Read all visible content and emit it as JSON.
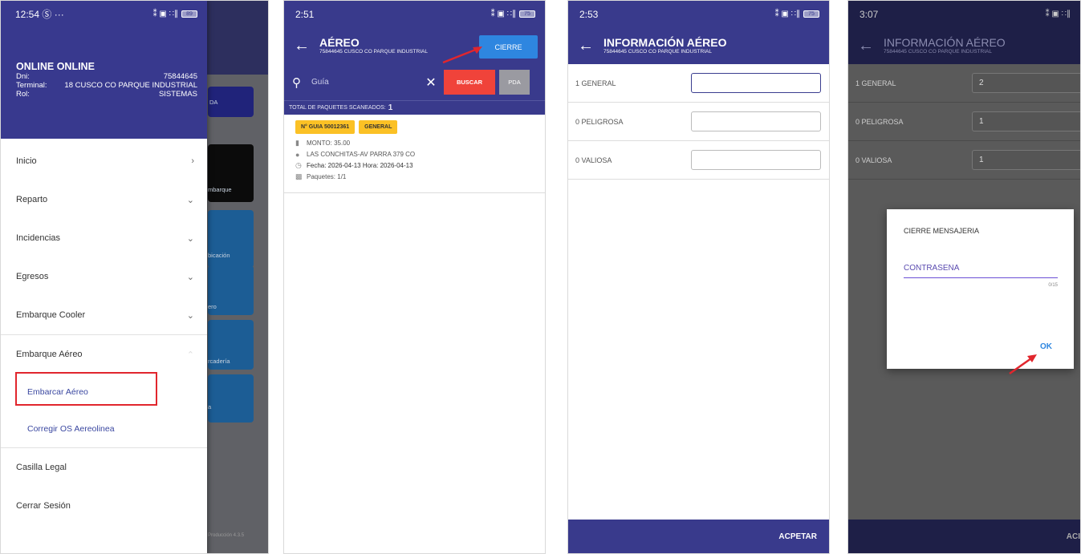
{
  "screen1": {
    "status_time": "12:54",
    "status_extra": "Ⓢ ···",
    "status_icons": "⁑ ▣ ∷∥",
    "battery": "89",
    "user_name": "ONLINE ONLINE",
    "dni_label": "Dni:",
    "dni_value": "75844645",
    "terminal_label": "Terminal:",
    "terminal_value": "18 CUSCO CO PARQUE INDUSTRIAL",
    "rol_label": "Rol:",
    "rol_value": "SISTEMAS",
    "menu": [
      {
        "label": "Inicio",
        "icon": "›"
      },
      {
        "label": "Reparto",
        "icon": "⌄"
      },
      {
        "label": "Incidencias",
        "icon": "⌄"
      },
      {
        "label": "Egresos",
        "icon": "⌄"
      },
      {
        "label": "Embarque Cooler",
        "icon": "⌄"
      },
      {
        "label": "Embarque Aéreo",
        "icon": "⌃"
      }
    ],
    "submenu": [
      "Embarcar Aéreo",
      "Corregir OS Aereolinea"
    ],
    "menu_bottom": [
      "Casilla Legal",
      "Cerrar Sesión"
    ],
    "bg_tiles": [
      "mbarque",
      "bicación",
      "ero",
      "rcadería",
      "a"
    ],
    "bg_partial": "DA",
    "footer": "Producción 4.3.5"
  },
  "screen2": {
    "status_time": "2:51",
    "status_icons": "⁑ ▣ ∷∥",
    "battery": "75",
    "title": "AÉREO",
    "subtitle": "75844645 CUSCO CO PARQUE INDUSTRIAL",
    "cierre_label": "CIERRE",
    "search_placeholder": "Guía",
    "buscar_label": "BUSCAR",
    "pda_label": "PDA",
    "total_label": "TOTAL DE PAQUETES SCANEADOS:",
    "total_value": "1",
    "card": {
      "guia": "N° GUIA 50012361",
      "tipo": "GENERAL",
      "monto": "MONTO: 35.00",
      "direccion": "LAS CONCHITAS-AV PARRA 379 CO",
      "fecha": "Fecha: 2026-04-13 Hora: 2026-04-13",
      "paquetes": "Paquetes: 1/1"
    }
  },
  "screen3": {
    "status_time": "2:53",
    "status_icons": "⁑ ▣ ∷∥",
    "battery": "75",
    "title": "INFORMACIÓN AÉREO",
    "subtitle": "75844645 CUSCO CO PARQUE INDUSTRIAL",
    "fields": [
      {
        "label": "1  GENERAL",
        "value": ""
      },
      {
        "label": "0  PELIGROSA",
        "value": ""
      },
      {
        "label": "0  VALIOSA",
        "value": ""
      }
    ],
    "accept_label": "ACPETAR"
  },
  "screen4": {
    "status_time": "3:07",
    "status_icons": "⁑ ▣ ∷∥",
    "title": "INFORMACIÓN AÉREO",
    "subtitle": "75844645 CUSCO CO PARQUE INDUSTRIAL",
    "fields": [
      {
        "label": "1  GENERAL",
        "value": "2"
      },
      {
        "label": "0  PELIGROSA",
        "value": "1"
      },
      {
        "label": "0  VALIOSA",
        "value": "1"
      }
    ],
    "dialog_title": "CIERRE MENSAJERIA",
    "password_placeholder": "CONTRASEÑA",
    "password_counter": "0/15",
    "ok_label": "OK",
    "accept_partial": "ACI"
  },
  "colors": {
    "primary": "#393a8c",
    "accent_blue": "#2e86e0",
    "danger_red": "#f0433a",
    "badge_yellow": "#fbc125",
    "annotation_red": "#e1262d"
  }
}
